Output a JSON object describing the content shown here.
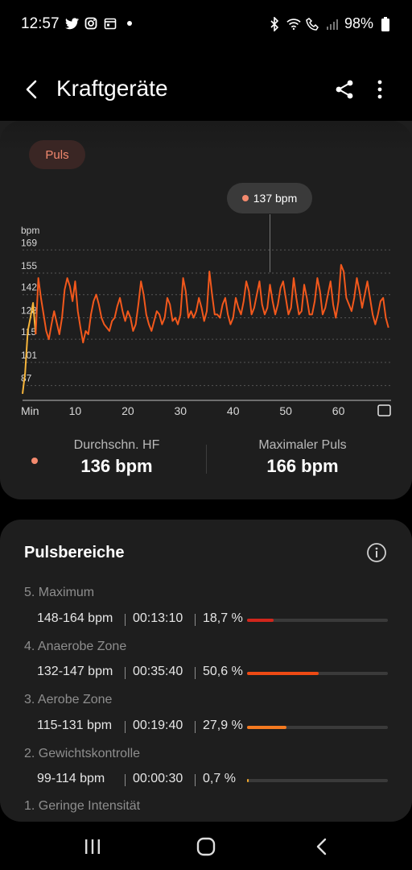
{
  "status": {
    "time": "12:57",
    "battery": "98%"
  },
  "app": {
    "title": "Kraftgeräte"
  },
  "chart_card": {
    "chip": "Puls",
    "tooltip": "137 bpm",
    "unit_label": "bpm"
  },
  "chart_data": {
    "type": "line",
    "ylabel": "bpm",
    "xlabel": "Min",
    "y_ticks": [
      169,
      155,
      142,
      128,
      115,
      101,
      87
    ],
    "x_ticks": [
      10,
      20,
      30,
      40,
      50,
      60
    ],
    "x_first_label": "Min",
    "ylim": [
      80,
      174
    ],
    "xlim": [
      0,
      70
    ],
    "tooltip_x": 47,
    "colors": {
      "early": "#f6b53b",
      "main": "#f2581c",
      "grid": "#555555"
    },
    "series": [
      {
        "x": [
          0,
          0.5,
          1,
          1.5,
          2,
          2.5,
          3,
          3.5,
          4,
          4.5,
          5,
          5.5,
          6,
          6.5,
          7,
          7.5,
          8,
          8.5,
          9,
          9.5,
          10,
          10.5,
          11,
          11.5,
          12,
          12.5,
          13,
          13.5,
          14,
          14.5,
          15,
          15.5,
          16,
          16.5,
          17,
          17.5,
          18,
          18.5,
          19,
          19.5,
          20,
          20.5,
          21,
          21.5,
          22,
          22.5,
          23,
          23.5,
          24,
          24.5,
          25,
          25.5,
          26,
          26.5,
          27,
          27.5,
          28,
          28.5,
          29,
          29.5,
          30,
          30.5,
          31,
          31.5,
          32,
          32.5,
          33,
          33.5,
          34,
          34.5,
          35,
          35.5,
          36,
          36.5,
          37,
          37.5,
          38,
          38.5,
          39,
          39.5,
          40,
          40.5,
          41,
          41.5,
          42,
          42.5,
          43,
          43.5,
          44,
          44.5,
          45,
          45.5,
          46,
          46.5,
          47,
          47.5,
          48,
          48.5,
          49,
          49.5,
          50,
          50.5,
          51,
          51.5,
          52,
          52.5,
          53,
          53.5,
          54,
          54.5,
          55,
          55.5,
          56,
          56.5,
          57,
          57.5,
          58,
          58.5,
          59,
          59.5,
          60,
          60.5,
          61,
          61.5,
          62,
          62.5,
          63,
          63.5,
          64,
          64.5,
          65,
          65.5,
          66,
          66.5,
          67,
          67.5,
          68,
          68.5,
          69,
          69.5
        ],
        "y": [
          82,
          95,
          120,
          128,
          137,
          118,
          152,
          140,
          130,
          120,
          115,
          124,
          132,
          125,
          118,
          128,
          145,
          152,
          147,
          138,
          150,
          132,
          122,
          113,
          120,
          118,
          130,
          138,
          142,
          136,
          128,
          124,
          122,
          120,
          126,
          128,
          135,
          140,
          132,
          126,
          132,
          128,
          120,
          124,
          136,
          150,
          142,
          130,
          124,
          120,
          126,
          132,
          130,
          124,
          128,
          140,
          136,
          126,
          128,
          124,
          130,
          152,
          144,
          128,
          132,
          128,
          132,
          140,
          134,
          126,
          132,
          156,
          142,
          130,
          130,
          128,
          136,
          140,
          130,
          124,
          128,
          140,
          134,
          130,
          138,
          150,
          144,
          130,
          134,
          142,
          150,
          136,
          130,
          134,
          148,
          138,
          130,
          136,
          146,
          150,
          140,
          130,
          134,
          152,
          140,
          130,
          132,
          148,
          140,
          130,
          130,
          138,
          152,
          144,
          130,
          134,
          142,
          150,
          136,
          128,
          138,
          160,
          156,
          140,
          136,
          132,
          140,
          152,
          144,
          134,
          142,
          150,
          140,
          130,
          124,
          130,
          138,
          140,
          128,
          122
        ]
      }
    ]
  },
  "stats": {
    "avg_label": "Durchschn. HF",
    "avg_value": "136 bpm",
    "max_label": "Maximaler Puls",
    "max_value": "166 bpm"
  },
  "zones_card": {
    "title": "Pulsbereiche",
    "zones": [
      {
        "name": "5. Maximum",
        "range": "148-164 bpm",
        "time": "00:13:10",
        "percent": "18,7 %",
        "fraction": 0.187,
        "color": "#d1261c"
      },
      {
        "name": "4. Anaerobe Zone",
        "range": "132-147 bpm",
        "time": "00:35:40",
        "percent": "50,6 %",
        "fraction": 0.506,
        "color": "#ee4a14"
      },
      {
        "name": "3. Aerobe Zone",
        "range": "115-131 bpm",
        "time": "00:19:40",
        "percent": "27,9 %",
        "fraction": 0.279,
        "color": "#f47a20"
      },
      {
        "name": "2. Gewichtskontrolle",
        "range": "99-114 bpm",
        "time": "00:00:30",
        "percent": "0,7 %",
        "fraction": 0.007,
        "color": "#f3a82a"
      },
      {
        "name": "1. Geringe Intensität"
      }
    ]
  }
}
